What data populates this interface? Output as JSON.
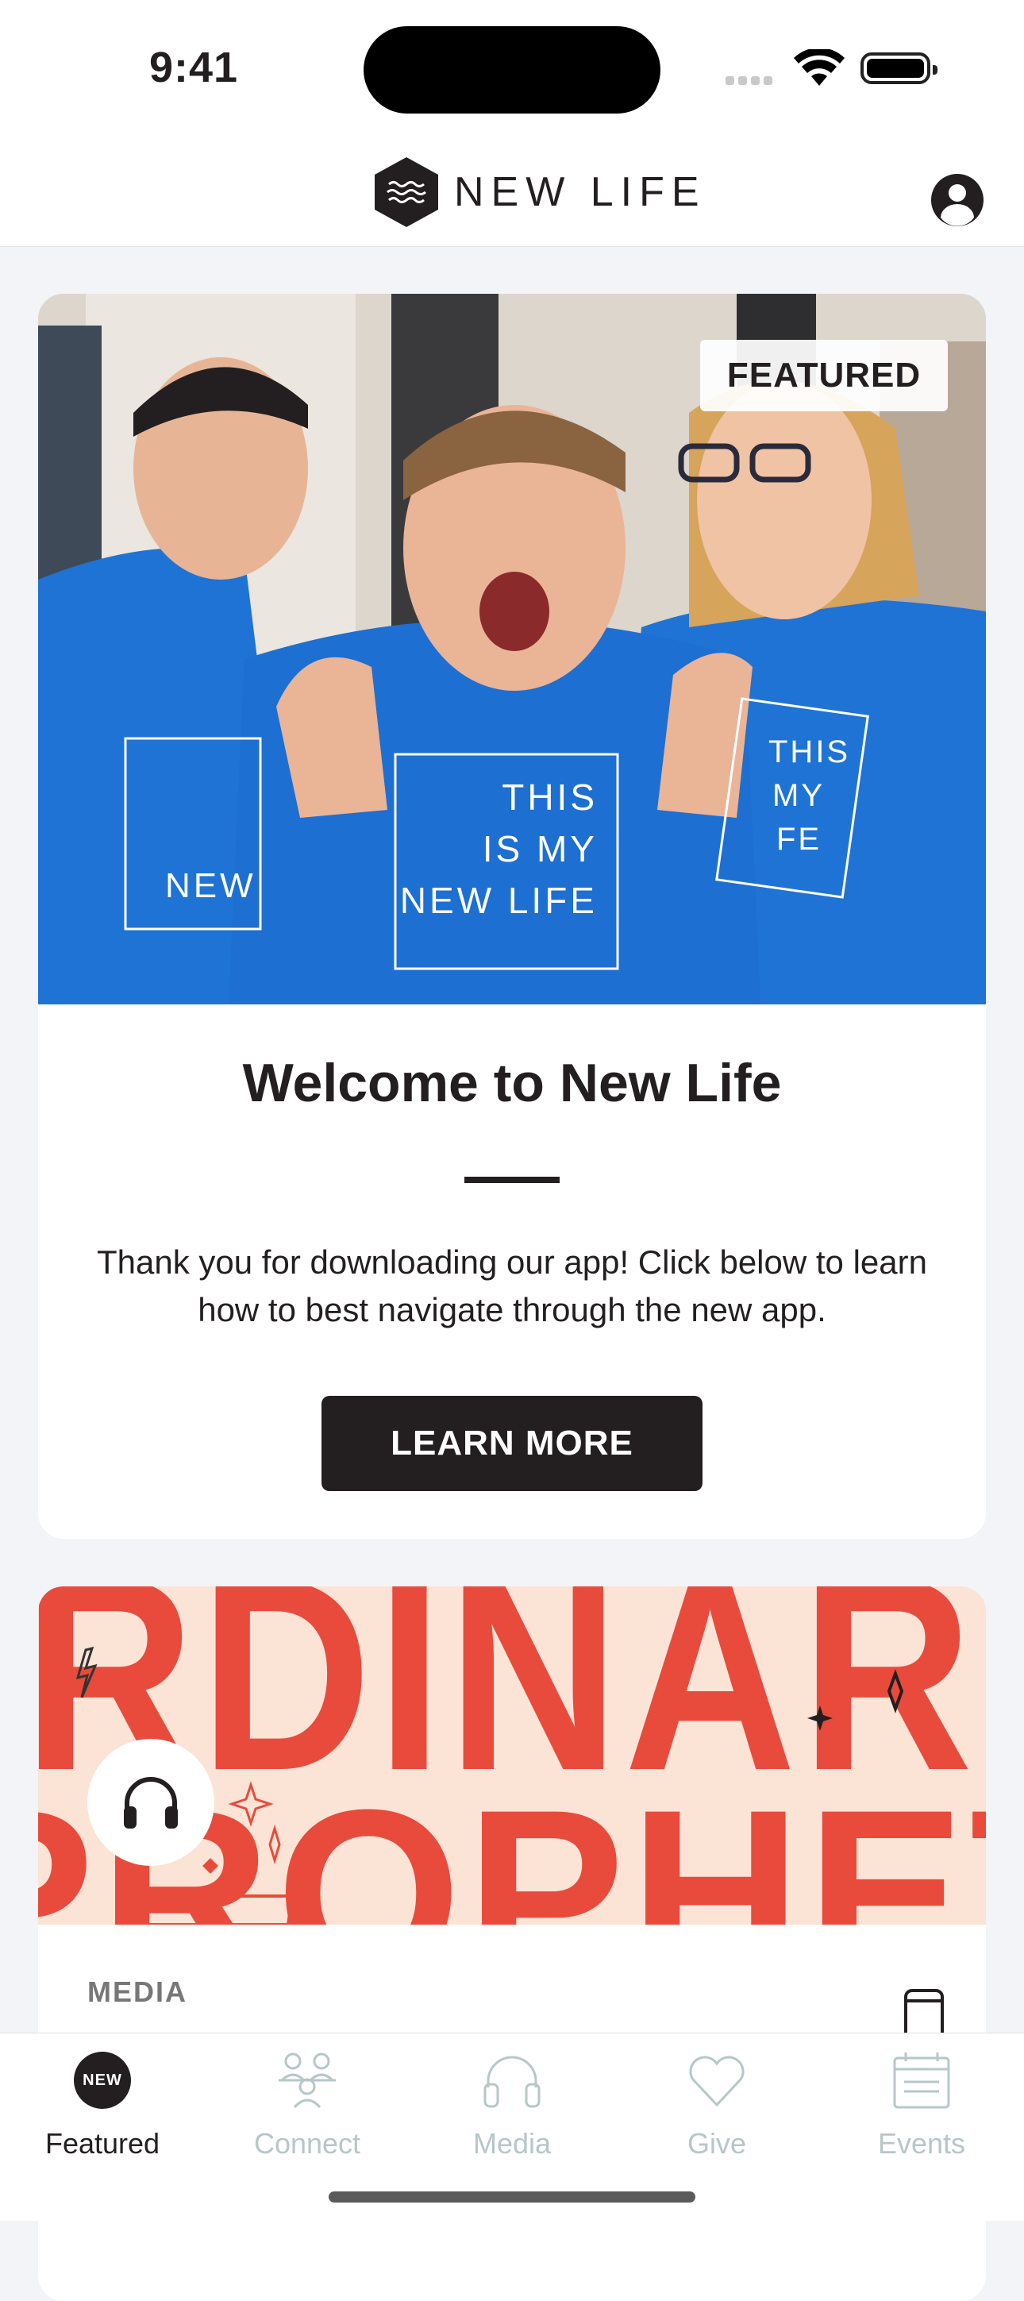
{
  "status": {
    "time": "9:41"
  },
  "header": {
    "brand": "NEW LIFE"
  },
  "featured_card": {
    "badge": "FEATURED",
    "title": "Welcome to New Life",
    "body": "Thank you for downloading our app! Click below to learn how to best navigate through the new app.",
    "cta_label": "LEARN MORE",
    "shirt_text_center": [
      "THIS",
      "IS MY",
      "NEW LIFE"
    ],
    "shirt_text_left": "NEW",
    "shirt_text_right": [
      "THIS",
      "MY",
      "FE"
    ]
  },
  "media_card": {
    "art_title_top": "ORDINARY",
    "art_title_bottom": "PROPHETS",
    "label": "MEDIA"
  },
  "tabbar": {
    "badge": "NEW",
    "tabs": [
      {
        "label": "Featured",
        "icon": "new-badge-icon"
      },
      {
        "label": "Connect",
        "icon": "people-icon"
      },
      {
        "label": "Media",
        "icon": "headphones-icon"
      },
      {
        "label": "Give",
        "icon": "heart-icon"
      },
      {
        "label": "Events",
        "icon": "calendar-icon"
      }
    ]
  },
  "colors": {
    "brand": "#231f20",
    "background": "#f3f4f8",
    "tab_inactive": "#b8c6c8",
    "shirt_blue": "#1f73d4",
    "art_red": "#e84b3c",
    "art_bg": "#fbe3d6"
  }
}
